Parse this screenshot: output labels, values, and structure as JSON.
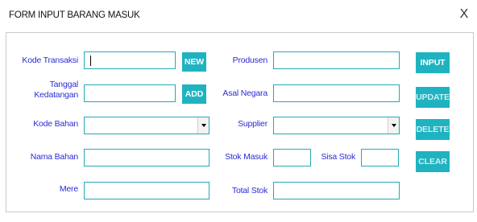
{
  "window": {
    "title": "FORM INPUT BARANG MASUK",
    "close_label": "X"
  },
  "left": {
    "kode_transaksi": {
      "label": "Kode Transaksi",
      "value": ""
    },
    "tanggal": {
      "label_line1": "Tanggal",
      "label_line2": "Kedatangan",
      "value": ""
    },
    "kode_bahan": {
      "label": "Kode Bahan",
      "value": ""
    },
    "nama_bahan": {
      "label": "Nama Bahan",
      "value": ""
    },
    "mere": {
      "label": "Mere",
      "value": ""
    },
    "new_button": "NEW",
    "add_button": "ADD"
  },
  "right": {
    "produsen": {
      "label": "Produsen",
      "value": ""
    },
    "asal_negara": {
      "label": "Asal Negara",
      "value": ""
    },
    "supplier": {
      "label": "Supplier",
      "value": ""
    },
    "stok_masuk": {
      "label": "Stok Masuk",
      "value": ""
    },
    "sisa_stok": {
      "label": "Sisa Stok",
      "value": ""
    },
    "total_stok": {
      "label": "Total Stok",
      "value": ""
    }
  },
  "actions": {
    "input": "INPUT",
    "update": "UPDATE",
    "delete": "DELETE",
    "clear": "CLEAR"
  },
  "colors": {
    "accent": "#1fb3c1",
    "label": "#2b2bd6",
    "border": "#26a8b7"
  }
}
